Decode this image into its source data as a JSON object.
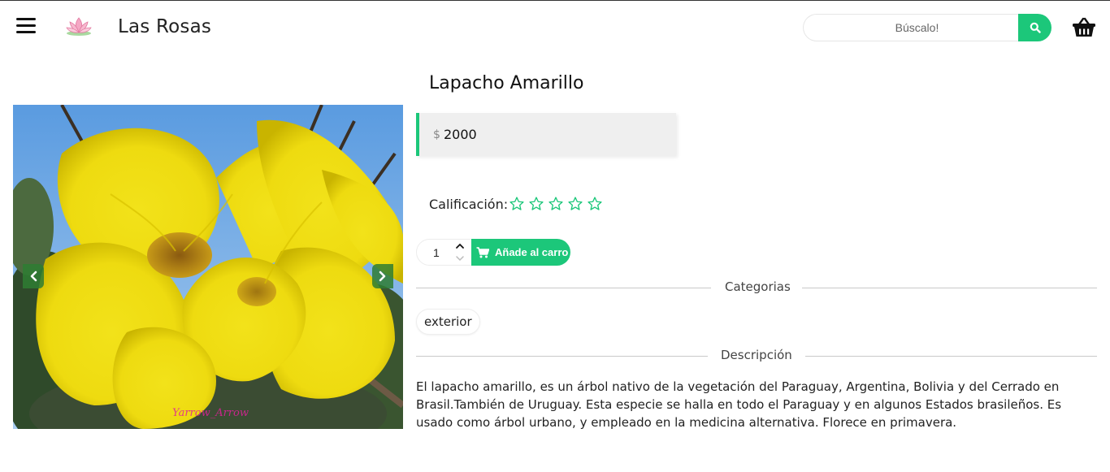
{
  "header": {
    "brand": "Las Rosas",
    "search_placeholder": "Búscalo!",
    "accent_color": "#1cc77a"
  },
  "product": {
    "title": "Lapacho Amarillo",
    "currency": "$",
    "price": "2000",
    "rating_label": "Calificación:",
    "rating_value": 0,
    "rating_max": 5,
    "quantity": "1",
    "add_to_cart_label": "Añade al carro",
    "categories_heading": "Categorias",
    "categories": [
      "exterior"
    ],
    "description_heading": "Descripción",
    "description": "El lapacho amarillo, es un árbol nativo de la vegetación del Paraguay, Argentina, Bolivia y del Cerrado en Brasil.También de Uruguay. Esta especie se halla en todo el Paraguay y en algunos Estados brasileños. Es usado como árbol urbano, y empleado en la medicina alternativa. Florece en primavera."
  },
  "gallery": {
    "watermark": "Yarrow_Arrow",
    "image_subject": "yellow lapacho flowers"
  },
  "icons": {
    "menu": "hamburger-icon",
    "logo": "lotus-icon",
    "search": "search-icon",
    "cart": "basket-icon",
    "prev": "chevron-left-icon",
    "next": "chevron-right-icon",
    "star": "star-outline-icon",
    "add": "cart-icon"
  }
}
